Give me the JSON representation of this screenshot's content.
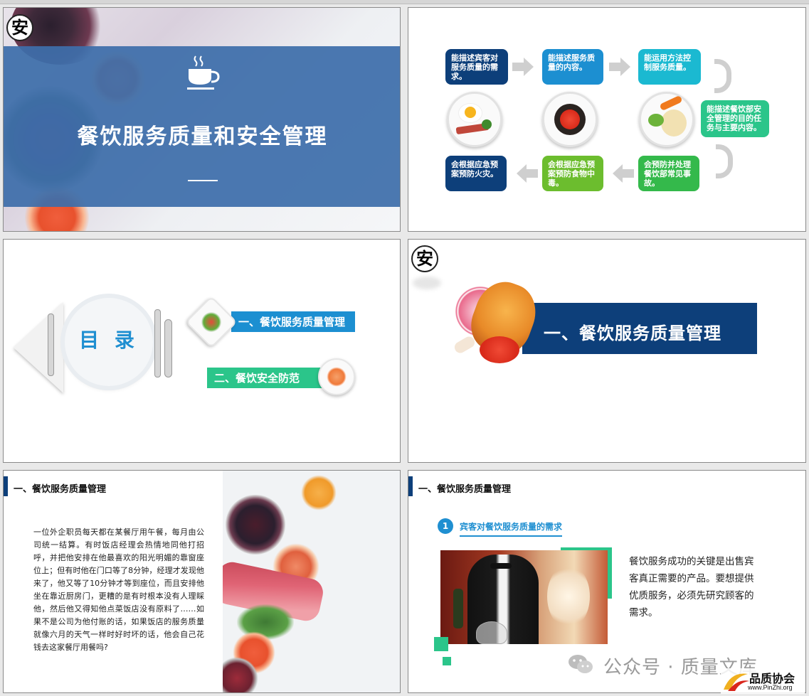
{
  "slide1": {
    "badge": "安",
    "title": "餐饮服务质量和安全管理"
  },
  "slide2": {
    "row1": [
      "能描述宾客对服务质量的需求。",
      "能描述服务质量的内容。",
      "能运用方法控制服务质量。"
    ],
    "right": "能描述餐饮部安全管理的目的任务与主要内容。",
    "row3": [
      "会根据应急预案预防火灾。",
      "会根据应急预案预防食物中毒。",
      "会预防并处理餐饮部常见事故。"
    ]
  },
  "slide3": {
    "title": "目 录",
    "items": [
      "一、餐饮服务质量管理",
      "二、餐饮安全防范"
    ]
  },
  "slide4": {
    "badge": "安",
    "title": "一、餐饮服务质量管理"
  },
  "slide5": {
    "section": "一、餐饮服务质量管理",
    "body": "一位外企职员每天都在某餐厅用午餐，每月由公司统一结算。有时饭店经理会热情地同他打招呼，并把他安排在他最喜欢的阳光明媚的靠窗座位上；但有时他在门口等了8分钟，经理才发现他来了，他又等了10分钟才等到座位，而且安排他坐在靠近厨房门，更糟的是有时根本没有人理睬他，然后他又得知他点菜饭店没有原料了……如果不是公司为他付账的话，如果饭店的服务质量就像六月的天气一样时好时坏的话，他会自己花钱去这家餐厅用餐吗?"
  },
  "slide6": {
    "section": "一、餐饮服务质量管理",
    "num": "1",
    "subhead": "宾客对餐饮服务质量的需求",
    "body": "餐饮服务成功的关键是出售宾客真正需要的产品。要想提供优质服务，必须先研究顾客的需求。"
  },
  "watermark": {
    "text": "公众号 · 质量文库",
    "brand": "品质协会",
    "url": "www.PinZhi.org"
  },
  "colors": {
    "navy": "#0d3f7a",
    "blue": "#1c8fd1",
    "green": "#2bc58a"
  }
}
